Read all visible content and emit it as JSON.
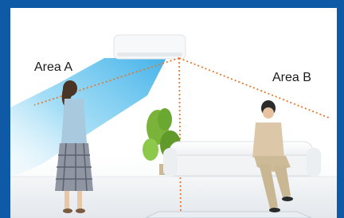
{
  "scene": {
    "area_a_label": "Area A",
    "area_b_label": "Area B"
  },
  "colors": {
    "frame_blue": "#0e5aa6",
    "airflow_blue": "#5cc0ee",
    "guide_line_orange": "#e8772a"
  }
}
